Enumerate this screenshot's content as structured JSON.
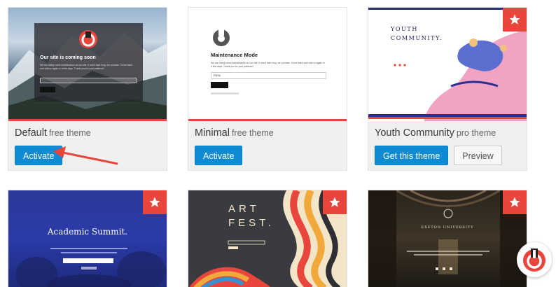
{
  "themes": [
    {
      "name": "Default",
      "type": "free theme",
      "buttons": [
        "Activate"
      ],
      "preview": {
        "title": "Our site is coming soon",
        "text": "We are doing some maintenance on our site. It won't take long, we promise. Come back and visit us again in a few days. Thank you for your patience!",
        "button": "Subscribe"
      }
    },
    {
      "name": "Minimal",
      "type": "free theme",
      "buttons": [
        "Activate"
      ],
      "preview": {
        "title": "Maintenance Mode",
        "text": "We are doing some maintenance on our site. It won't take long, we promise. Come back and visit us again in a few days. Thank you for your patience!",
        "input_value": "EMAIL",
        "button": "Subscribe"
      }
    },
    {
      "name": "Youth Community",
      "type": "pro theme",
      "buttons": [
        "Get this theme",
        "Preview"
      ],
      "preview": {
        "title_line1": "YOUTH",
        "title_line2": "COMMUNITY."
      }
    },
    {
      "preview": {
        "title": "Academic Summit."
      }
    },
    {
      "preview": {
        "title_line1": "ART",
        "title_line2": "FEST."
      }
    },
    {
      "preview": {
        "title": "EXETON UNIVERSITY"
      }
    }
  ],
  "colors": {
    "accent": "#0f8bd6",
    "pro_badge": "#e8453c",
    "arrow": "#e8453c"
  },
  "icons": {
    "pro_badge": "star-icon",
    "logo": "power-logo-icon"
  }
}
